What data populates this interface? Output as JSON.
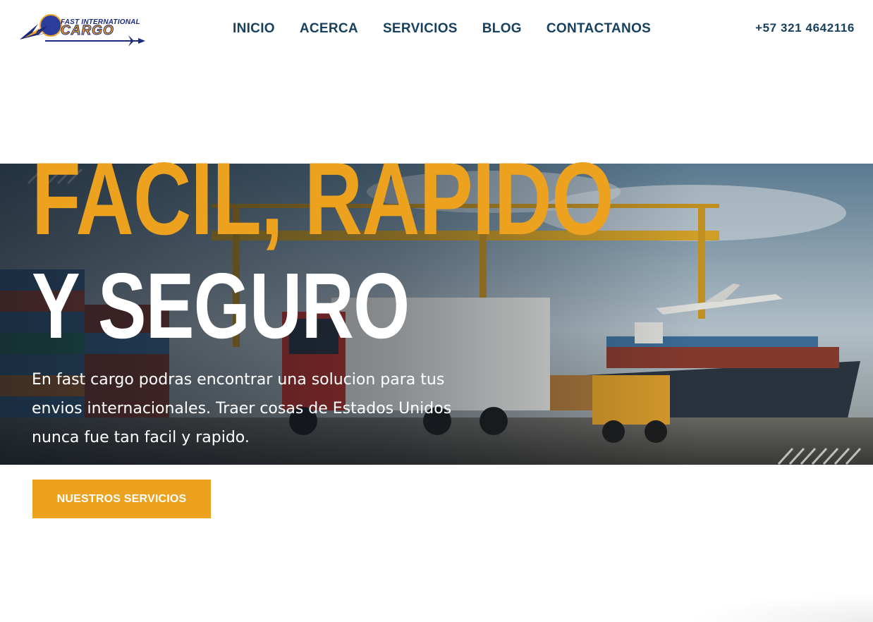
{
  "brand": {
    "name_small": "FAST INTERNATIONAL",
    "name_large": "CARGO"
  },
  "nav": {
    "items": [
      {
        "label": "INICIO"
      },
      {
        "label": "ACERCA"
      },
      {
        "label": "SERVICIOS"
      },
      {
        "label": "BLOG"
      },
      {
        "label": "CONTACTANOS"
      }
    ]
  },
  "contact": {
    "phone": "+57 321 4642116"
  },
  "hero": {
    "headline_line1": "FACIL, RAPIDO",
    "headline_line2": "Y SEGURO",
    "description": "En fast cargo podras encontrar una solucion para tus envios internacionales. Traer cosas de Estados Unidos nunca fue tan facil y rapido.",
    "cta_label": "NUESTROS SERVICIOS"
  },
  "colors": {
    "accent": "#eca21f",
    "nav_text": "#17415e",
    "headline_white": "#ffffff"
  },
  "icons": [
    "eagle-plane-logo-icon",
    "airplane-icon"
  ]
}
